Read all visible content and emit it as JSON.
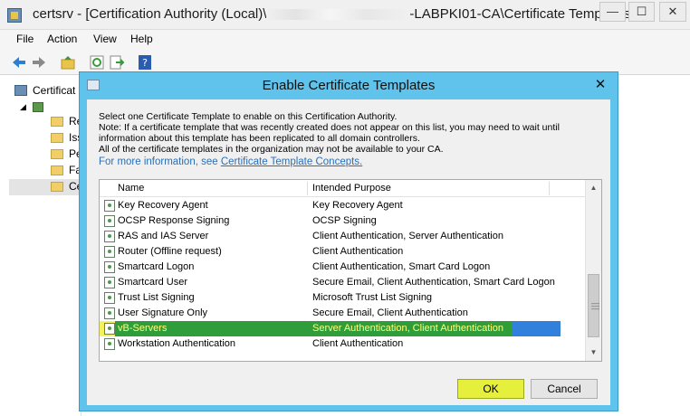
{
  "window": {
    "title": "certsrv - [Certification Authority (Local)\\",
    "title_suffix": "-LABPKI01-CA\\Certificate Templates]",
    "minimize": "—",
    "maximize": "☐",
    "close": "✕"
  },
  "menu": [
    "File",
    "Action",
    "View",
    "Help"
  ],
  "tree": {
    "root_label": "Certificat",
    "folders": [
      "Re",
      "Iss",
      "Pe",
      "Fa",
      "Ce"
    ]
  },
  "dialog": {
    "title": "Enable Certificate Templates",
    "close": "✕",
    "intro_lines": [
      "Select one Certificate Template to enable on this Certification Authority.",
      "Note: If a certificate template that was recently created does not appear on this list, you may need to wait until",
      "information about this template has been replicated to all domain controllers.",
      "All of the certificate templates in the organization may not be available to your CA."
    ],
    "info_prefix": "For more information, see ",
    "info_link": "Certificate Template Concepts.",
    "columns": {
      "name": "Name",
      "purpose": "Intended Purpose"
    },
    "rows": [
      {
        "name": "Key Recovery Agent",
        "purpose": "Key Recovery Agent"
      },
      {
        "name": "OCSP Response Signing",
        "purpose": "OCSP Signing"
      },
      {
        "name": "RAS and IAS Server",
        "purpose": "Client Authentication, Server Authentication"
      },
      {
        "name": "Router (Offline request)",
        "purpose": "Client Authentication"
      },
      {
        "name": "Smartcard Logon",
        "purpose": "Client Authentication, Smart Card Logon"
      },
      {
        "name": "Smartcard User",
        "purpose": "Secure Email, Client Authentication, Smart Card Logon"
      },
      {
        "name": "Trust List Signing",
        "purpose": "Microsoft Trust List Signing"
      },
      {
        "name": "User Signature Only",
        "purpose": "Secure Email, Client Authentication"
      },
      {
        "name": "vB-Servers",
        "purpose": "Server Authentication, Client Authentication"
      },
      {
        "name": "Workstation Authentication",
        "purpose": "Client Authentication"
      }
    ],
    "ok": "OK",
    "cancel": "Cancel"
  },
  "colors": {
    "dialog_frame": "#5fc3ec",
    "selection_green": "#2f9e3a",
    "selection_blue": "#3080dc",
    "highlight_yellow": "#e6ef3c",
    "link": "#2a6fb8"
  }
}
